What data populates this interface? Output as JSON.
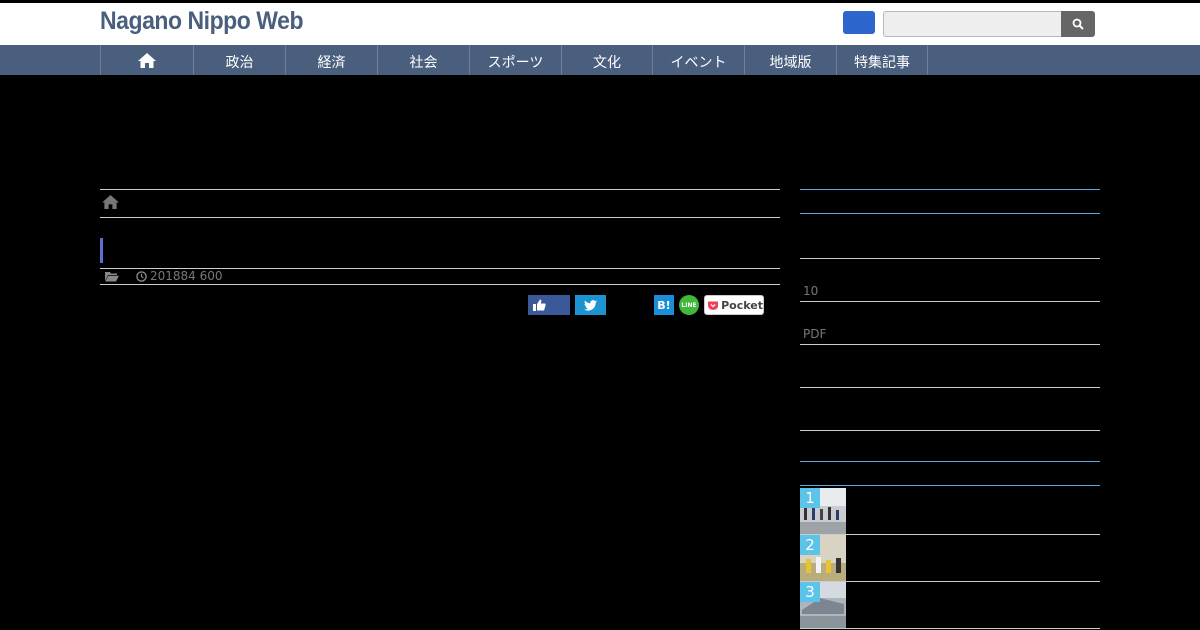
{
  "site": {
    "title": "Nagano Nippo Web",
    "search_placeholder": ""
  },
  "nav": {
    "items": [
      {
        "label": "政治"
      },
      {
        "label": "経済"
      },
      {
        "label": "社会"
      },
      {
        "label": "スポーツ"
      },
      {
        "label": "文化"
      },
      {
        "label": "イベント"
      },
      {
        "label": "地域版"
      },
      {
        "label": "特集記事"
      }
    ]
  },
  "article": {
    "meta_date": "201884 600"
  },
  "share": {
    "hatena_label": "B!",
    "line_label": "LINE",
    "pocket_label": "Pocket"
  },
  "sidebar": {
    "text_10": "10",
    "text_pdf": "PDF",
    "ranking": [
      {
        "rank": "1"
      },
      {
        "rank": "2"
      },
      {
        "rank": "3"
      }
    ]
  },
  "colors": {
    "nav_bg": "#4a5f7e",
    "accent": "#5a6fd0",
    "rank_badge": "#5bc4e8"
  }
}
